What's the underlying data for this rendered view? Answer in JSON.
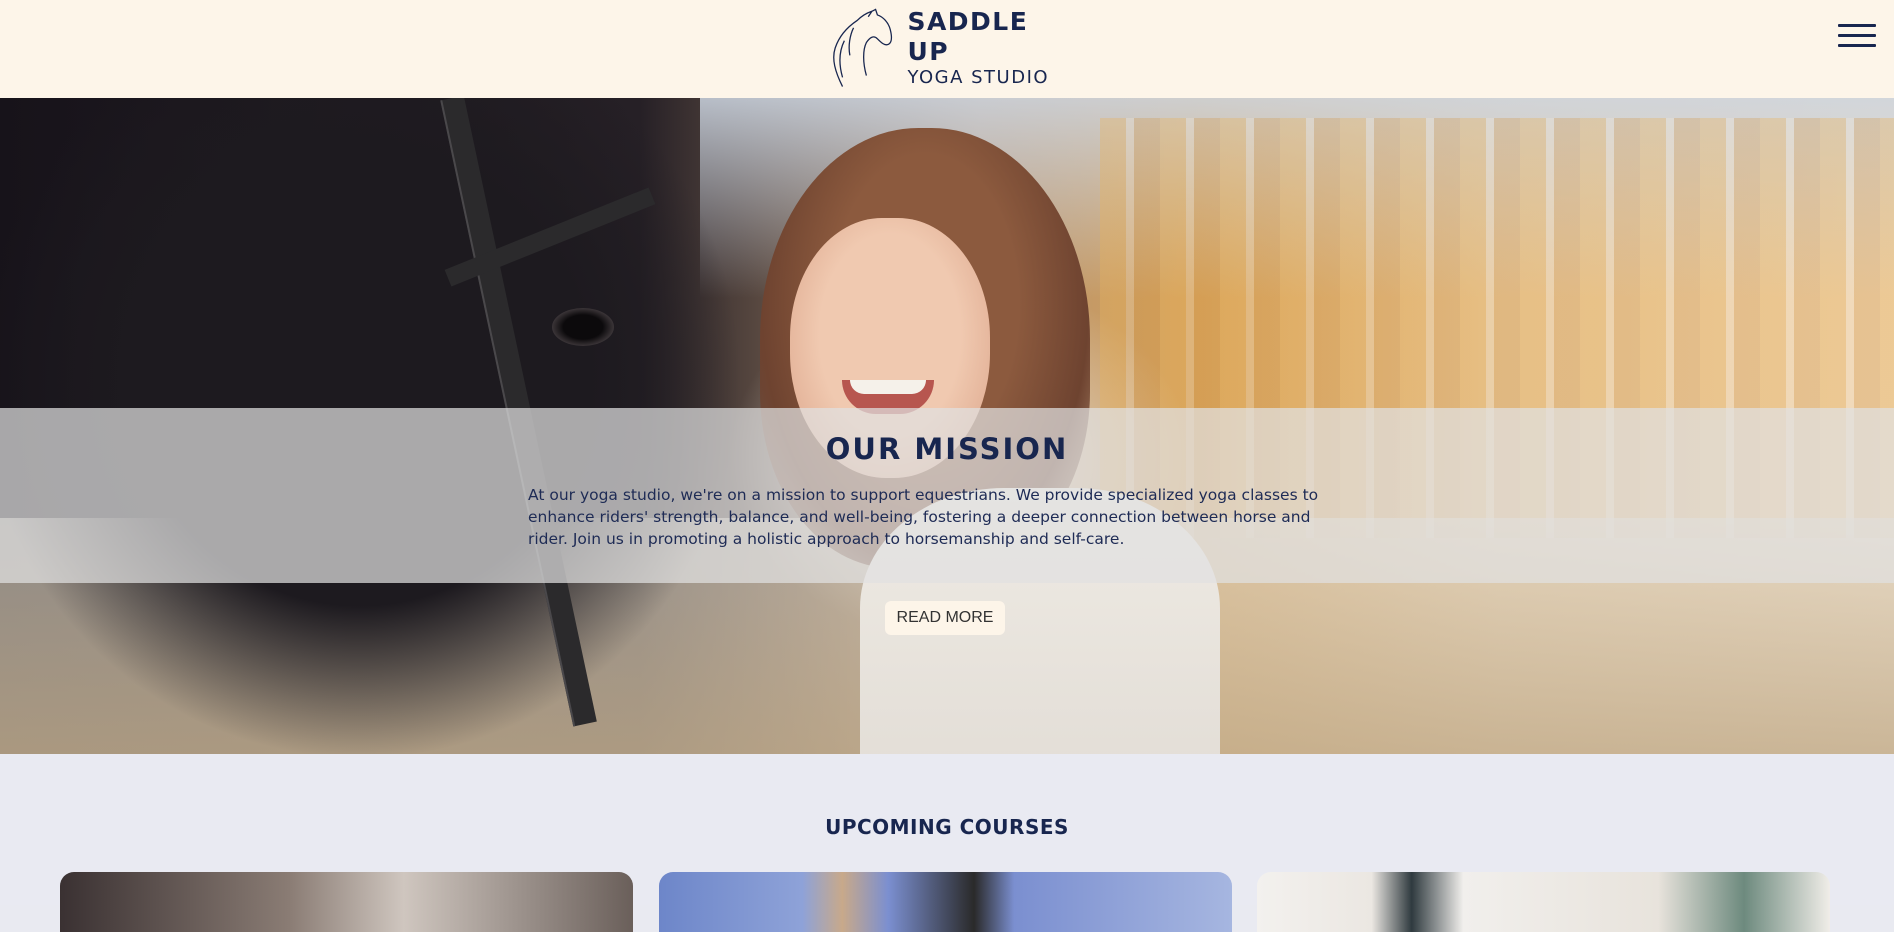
{
  "header": {
    "logo_title": "SADDLE UP",
    "logo_subtitle": "YOGA STUDIO",
    "logo_icon": "horse-head-icon",
    "menu_icon": "hamburger-menu-icon"
  },
  "hero": {
    "image": "woman-hugging-horse",
    "mission_title": "OUR MISSION",
    "mission_text": "At our yoga studio, we're on a mission to support equestrians. We provide specialized yoga classes to enhance riders' strength, balance, and well-being, fostering a deeper connection between horse and rider. Join us in promoting a holistic approach to horsemanship and self-care.",
    "read_more_label": "READ MORE"
  },
  "courses": {
    "title": "UPCOMING COURSES",
    "cards": [
      {
        "image": "yoga-class-image"
      },
      {
        "image": "horse-yoga-image"
      },
      {
        "image": "studio-interior-image"
      }
    ]
  },
  "colors": {
    "navy": "#18264f",
    "cream": "#fdf5e9",
    "section_bg": "#e9eaf2"
  }
}
